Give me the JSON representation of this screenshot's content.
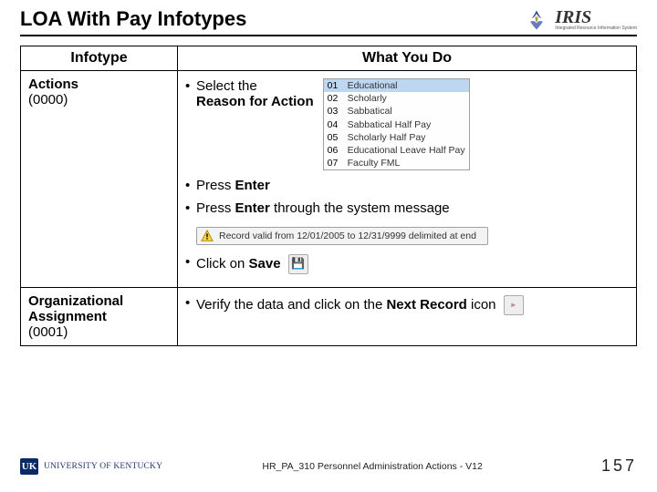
{
  "title": "LOA With Pay Infotypes",
  "logo": {
    "text": "IRIS",
    "subtitle": "Integrated Resource Information System"
  },
  "table": {
    "header_left": "Infotype",
    "header_right": "What You Do",
    "rows": [
      {
        "infotype_name": "Actions",
        "infotype_num": "(0000)",
        "select_prefix": "Select the",
        "select_bold": "Reason for Action",
        "dropdown": [
          {
            "code": "01",
            "label": "Educational"
          },
          {
            "code": "02",
            "label": "Scholarly"
          },
          {
            "code": "03",
            "label": "Sabbatical"
          },
          {
            "code": "04",
            "label": "Sabbatical Half Pay"
          },
          {
            "code": "05",
            "label": "Scholarly Half Pay"
          },
          {
            "code": "06",
            "label": "Educational Leave Half Pay"
          },
          {
            "code": "07",
            "label": "Faculty FML"
          }
        ],
        "press1_pre": "Press ",
        "press1_bold": "Enter",
        "press2_pre": "Press ",
        "press2_bold": "Enter",
        "press2_post": " through the system message",
        "msg": "Record valid from 12/01/2005 to 12/31/9999 delimited at end",
        "click_pre": "Click on ",
        "click_bold": "Save"
      },
      {
        "infotype_name": "Organizational Assignment",
        "infotype_num": "(0001)",
        "verify_pre": "Verify the data and click on the ",
        "verify_bold": "Next Record",
        "verify_post": " icon"
      }
    ]
  },
  "footer": {
    "uk_text": "UNIVERSITY OF KENTUCKY",
    "mid": "HR_PA_310 Personnel Administration Actions - V12",
    "page": "157"
  }
}
